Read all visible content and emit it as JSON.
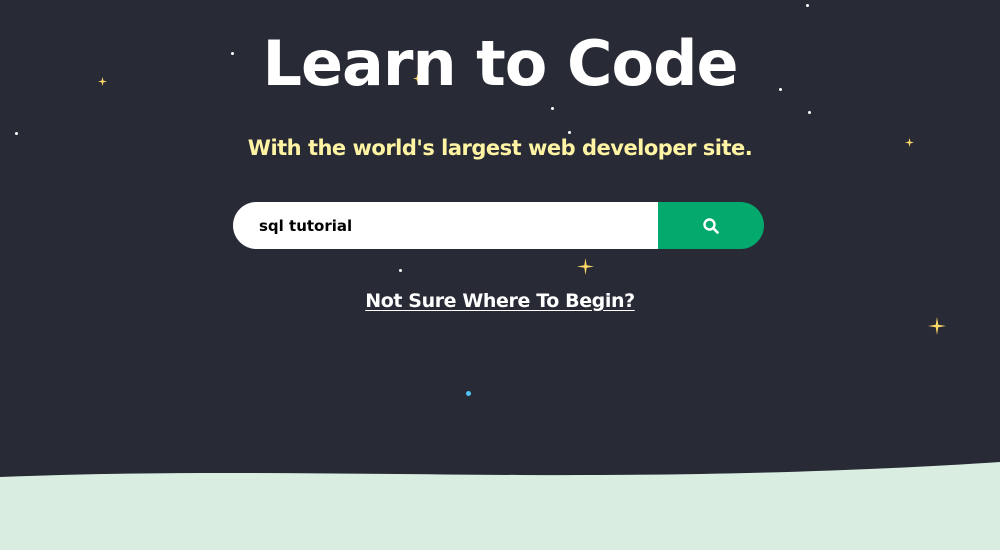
{
  "hero": {
    "title": "Learn to Code",
    "subtitle": "With the world's largest web developer site.",
    "link_label": "Not Sure Where To Begin?"
  },
  "search": {
    "value": "sql tutorial",
    "icon": "search-icon"
  },
  "colors": {
    "background": "#282a35",
    "title": "#ffffff",
    "subtitle": "#fff4a3",
    "search_button": "#04aa6d",
    "bottom_wave": "#d9eee1",
    "star": "#ffd966",
    "blue_dot": "#4fc3f7"
  }
}
